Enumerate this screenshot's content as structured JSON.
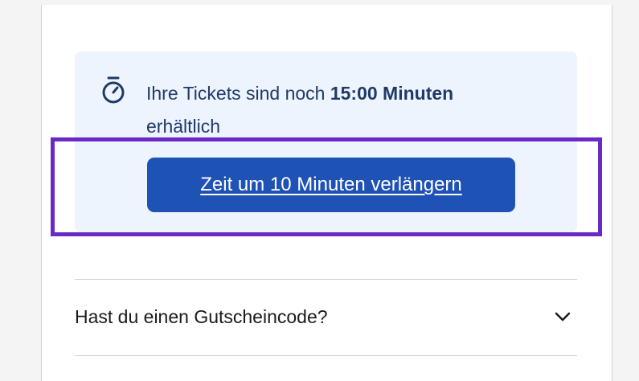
{
  "timer": {
    "text_prefix": "Ihre Tickets sind noch",
    "time_strong": "15:00 Minuten",
    "text_suffix": "erhältlich",
    "icon": "stopwatch-icon"
  },
  "extend_button": {
    "label": "Zeit um 10 Minuten verlängern"
  },
  "voucher": {
    "label": "Hast du einen Gutscheincode?",
    "icon": "chevron-down-icon"
  },
  "colors": {
    "primary": "#1f52b5",
    "highlight": "#6a28c7",
    "info_background": "#eef4fd",
    "text_dark_blue": "#1f3a68"
  }
}
